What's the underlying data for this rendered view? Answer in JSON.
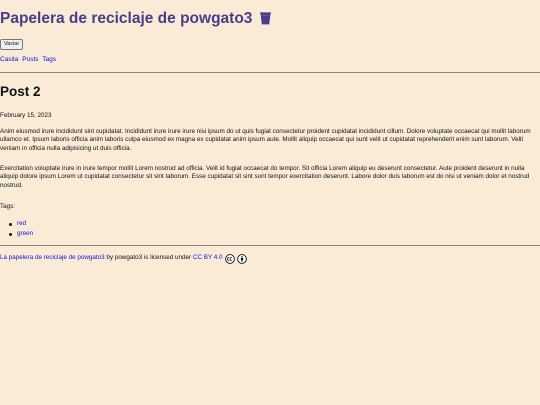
{
  "header": {
    "title": "Papelera de reciclaje de powgato3",
    "title_icon": "trash-can-icon",
    "empty_button_label": "Vaciar"
  },
  "nav": {
    "links": [
      {
        "label": "Casita"
      },
      {
        "label": "Posts"
      },
      {
        "label": "Tags"
      }
    ]
  },
  "post": {
    "title": "Post 2",
    "date": "February 15, 2023",
    "paragraphs": [
      "Anim eiusmod irure incididunt sint cupidatat. Incididunt irure irure irure nisi ipsum do ut quis fugiat consectetur proident cupidatat incididunt cillum. Dolore voluptate occaecat qui mollit laborum ullamco et. Ipsum laboris officia anim laboris culpa eiusmod ex magna ex cupidatat anim ipsum aute. Mollit aliquip occaecat qui sunt velit ut cupidatat reprehenderit enim sunt laborum. Velit veniam in officia nulla adipisicing ut duis officia.",
      "Exercitation voluptate irure in irure tempor mollit Lorem nostrud ad officia. Velit id fugiat occaecat do tempor. Sit officia Lorem aliquip eu deserunt consectetur. Aute proident deserunt in nulla aliquip dolore ipsum Lorem ut cupidatat consectetur sit sint laborum. Esse cupidatat sit sint sunt tempor exercitation deserunt. Labore dolor duis laborum est do nisi ut veniam dolor et nostrud nostrud."
    ],
    "tags_label": "Tags:",
    "tags": [
      "red",
      "green"
    ]
  },
  "footer": {
    "site_link": "La papelera de reciclaje de powgato3",
    "by_text": " by powgato3 is licensed under ",
    "license_link": "CC BY 4.0",
    "license_icons": [
      "creative-commons-icon",
      "attribution-icon"
    ]
  },
  "colors": {
    "background": "#faebd7",
    "title": "#483d8b",
    "link": "#1111dd"
  }
}
